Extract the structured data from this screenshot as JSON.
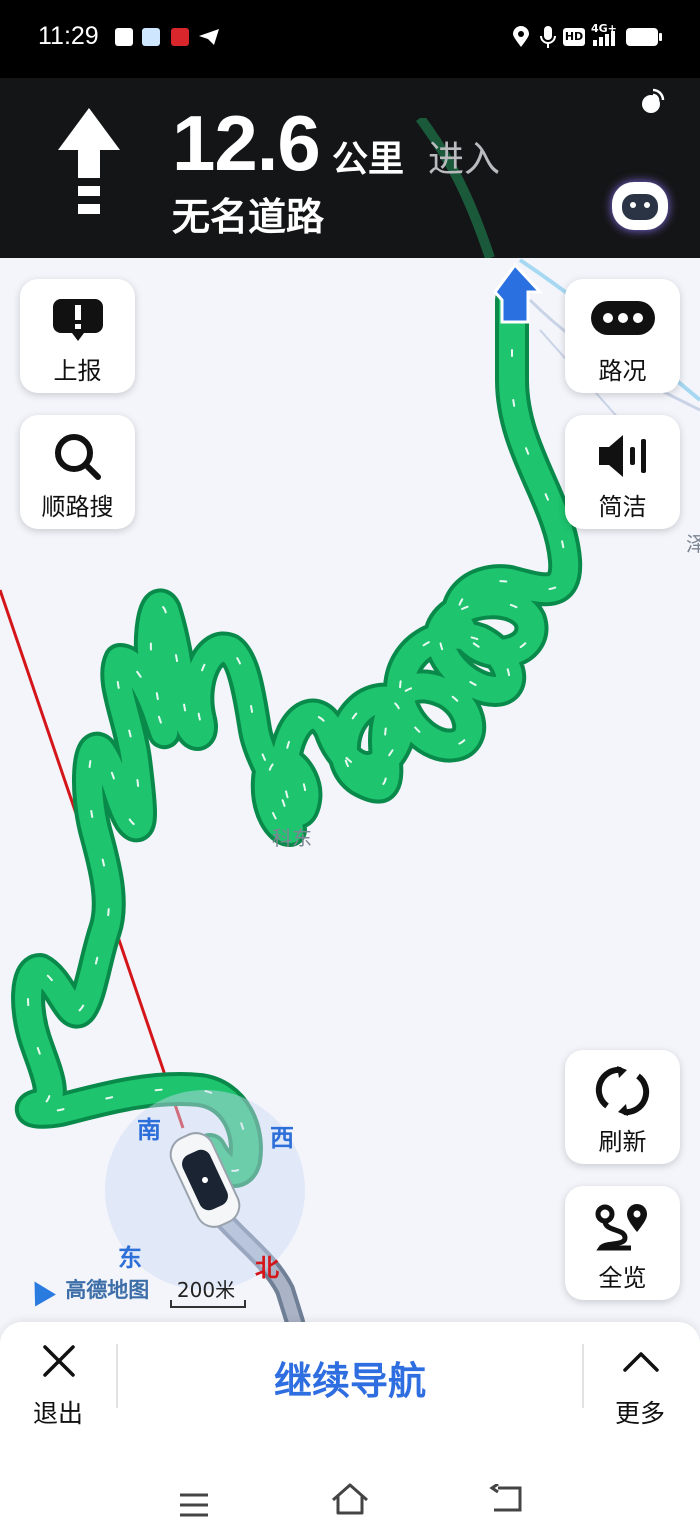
{
  "status_bar": {
    "time": "11:29",
    "left_icons": [
      "checklist-icon",
      "app-icon",
      "app-icon-red",
      "telegram-icon"
    ],
    "right_icons": [
      "location-icon",
      "mic-icon",
      "hd-icon",
      "signal-icon",
      "battery-icon"
    ],
    "hd_label": "HD",
    "net_label": "4G+"
  },
  "nav_header": {
    "turn_icon": "straight-arrow-icon",
    "distance": "12.6",
    "unit": "公里",
    "action": "进入",
    "road_name": "无名道路"
  },
  "left_buttons": [
    {
      "label": "上报",
      "icon": "report-icon"
    },
    {
      "label": "顺路搜",
      "icon": "search-icon"
    }
  ],
  "right_buttons": [
    {
      "label": "路况",
      "icon": "more-dots-icon"
    },
    {
      "label": "简洁",
      "icon": "speaker-icon"
    },
    {
      "label": "刷新",
      "icon": "refresh-icon"
    },
    {
      "label": "全览",
      "icon": "overview-route-icon"
    }
  ],
  "map": {
    "place_label": "科东",
    "edge_label": "泽",
    "compass": {
      "south": "南",
      "west": "西",
      "east": "东",
      "north": "北"
    },
    "logo_text": "高德地图",
    "scale_label": "200米",
    "route_color": "#1ec46e",
    "route_border": "#0a8a4a"
  },
  "bottom_bar": {
    "exit_label": "退出",
    "continue_label": "继续导航",
    "more_label": "更多"
  },
  "system_nav": [
    "menu-icon",
    "home-icon",
    "back-icon"
  ]
}
